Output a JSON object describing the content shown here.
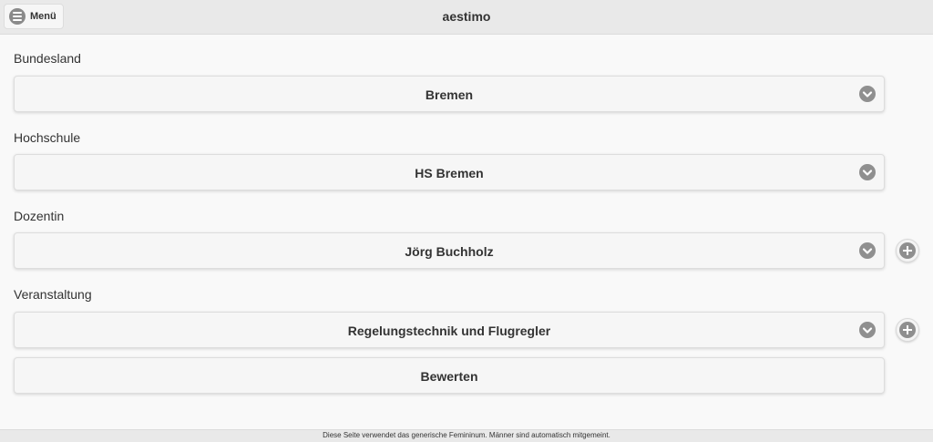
{
  "header": {
    "title": "aestimo",
    "menu_label": "Menü"
  },
  "fields": {
    "bundesland": {
      "label": "Bundesland",
      "value": "Bremen"
    },
    "hochschule": {
      "label": "Hochschule",
      "value": "HS Bremen"
    },
    "dozentin": {
      "label": "Dozentin",
      "value": "Jörg Buchholz"
    },
    "veranstaltung": {
      "label": "Veranstaltung",
      "value": "Regelungstechnik und Flugregler"
    }
  },
  "actions": {
    "rate_label": "Bewerten"
  },
  "footer": {
    "text": "Diese Seite verwendet das generische Femininum. Männer sind automatisch mitgemeint."
  },
  "icons": {
    "menu": "menu-icon",
    "dropdown": "chevron-down-icon",
    "add": "plus-icon"
  }
}
